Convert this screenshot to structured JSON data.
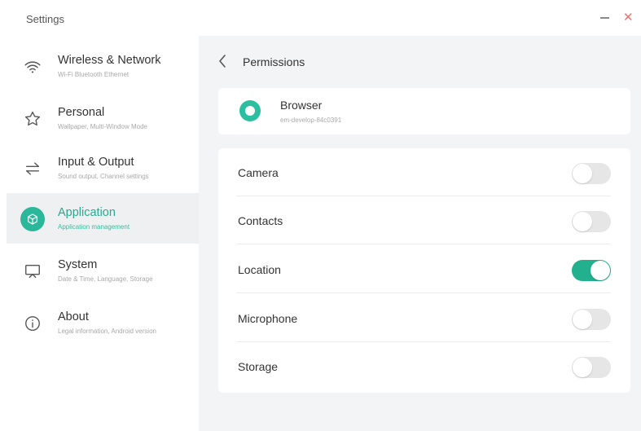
{
  "window": {
    "title": "Settings",
    "minimize_icon": "minimize-icon",
    "close_icon": "close-icon",
    "close_glyph": "✕"
  },
  "sidebar": {
    "items": [
      {
        "title": "Wireless & Network",
        "subtitle": "Wi-Fi Bluetooth Ethernet",
        "icon": "wifi-icon",
        "active": false
      },
      {
        "title": "Personal",
        "subtitle": "Wallpaper, Multi-Window Mode",
        "icon": "star-icon",
        "active": false
      },
      {
        "title": "Input & Output",
        "subtitle": "Sound output, Channel settings",
        "icon": "swap-arrows-icon",
        "active": false
      },
      {
        "title": "Application",
        "subtitle": "Application management",
        "icon": "cube-icon",
        "active": true
      },
      {
        "title": "System",
        "subtitle": "Date & Time, Language, Storage",
        "icon": "monitor-icon",
        "active": false
      },
      {
        "title": "About",
        "subtitle": "Legal information, Android version",
        "icon": "info-icon",
        "active": false
      }
    ]
  },
  "main": {
    "title": "Permissions",
    "back_icon": "chevron-left-icon",
    "app": {
      "name": "Browser",
      "package": "em-develop-84c0391",
      "icon": "browser-app-icon"
    },
    "permissions": [
      {
        "label": "Camera",
        "enabled": false
      },
      {
        "label": "Contacts",
        "enabled": false
      },
      {
        "label": "Location",
        "enabled": true
      },
      {
        "label": "Microphone",
        "enabled": false
      },
      {
        "label": "Storage",
        "enabled": false
      }
    ]
  },
  "colors": {
    "accent": "#22b08f",
    "active_row_bg": "#eef0f2",
    "content_bg": "#f3f4f6",
    "close_red": "#e57373"
  }
}
